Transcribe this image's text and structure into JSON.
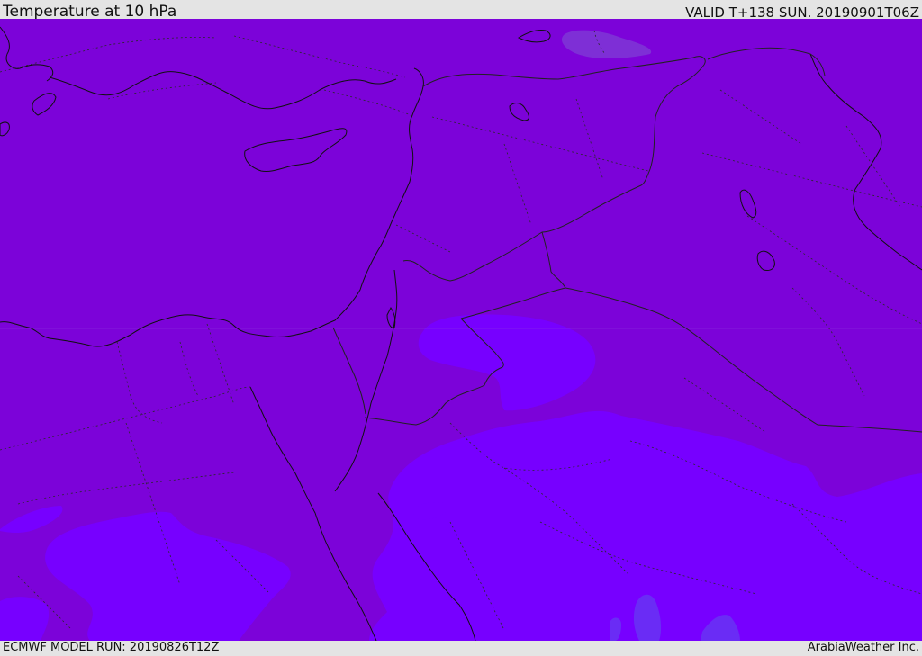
{
  "header": {
    "title": "Temperature at 10 hPa",
    "valid": "VALID T+138 SUN. 20190901T06Z"
  },
  "footer": {
    "model_run": "ECMWF MODEL RUN: 20190826T12Z",
    "credit": "ArabiaWeather Inc."
  },
  "colors": {
    "background_field": "#7c03d9",
    "warm_patch": "#7e2fd6",
    "cold_field": "#7700ff",
    "colder_cells": "#6a2cf5",
    "coastline": "#111111",
    "border": "#222222"
  }
}
